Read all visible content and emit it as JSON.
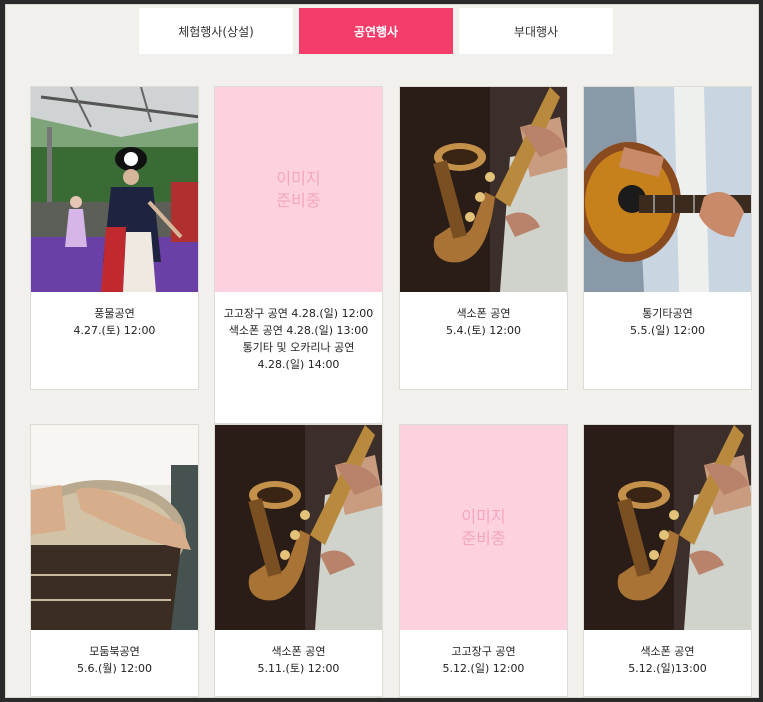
{
  "tabs": [
    {
      "label": "체험행사(상설)",
      "active": false
    },
    {
      "label": "공연행사",
      "active": true
    },
    {
      "label": "부대행사",
      "active": false
    }
  ],
  "placeholder_text": "이미지\n준비중",
  "cards": [
    {
      "image": "pungmul-performance-photo",
      "lines": [
        "풍물공연",
        "4.27.(토) 12:00"
      ]
    },
    {
      "image": "placeholder",
      "lines": [
        "고고장구 공연 4.28.(일) 12:00",
        "색소폰 공연 4.28.(일) 13:00",
        "통기타 및 오카리나 공연",
        "4.28.(일) 14:00"
      ]
    },
    {
      "image": "saxophone-photo",
      "lines": [
        "색소폰 공연",
        "5.4.(토) 12:00"
      ]
    },
    {
      "image": "acoustic-guitar-photo",
      "lines": [
        "통기타공연",
        "5.5.(일) 12:00"
      ]
    },
    {
      "image": "djembe-drum-photo",
      "lines": [
        "모둠북공연",
        "5.6.(월) 12:00"
      ]
    },
    {
      "image": "saxophone-photo",
      "lines": [
        "색소폰 공연",
        "5.11.(토) 12:00"
      ]
    },
    {
      "image": "placeholder",
      "lines": [
        "고고장구 공연",
        "5.12.(일) 12:00"
      ]
    },
    {
      "image": "saxophone-photo",
      "lines": [
        "색소폰 공연",
        "5.12.(일)13:00"
      ]
    }
  ],
  "colors": {
    "accent": "#f43d6a",
    "placeholder_bg": "#fdd2de",
    "placeholder_text": "#f4a7bc",
    "page_bg": "#f1f0ec"
  }
}
